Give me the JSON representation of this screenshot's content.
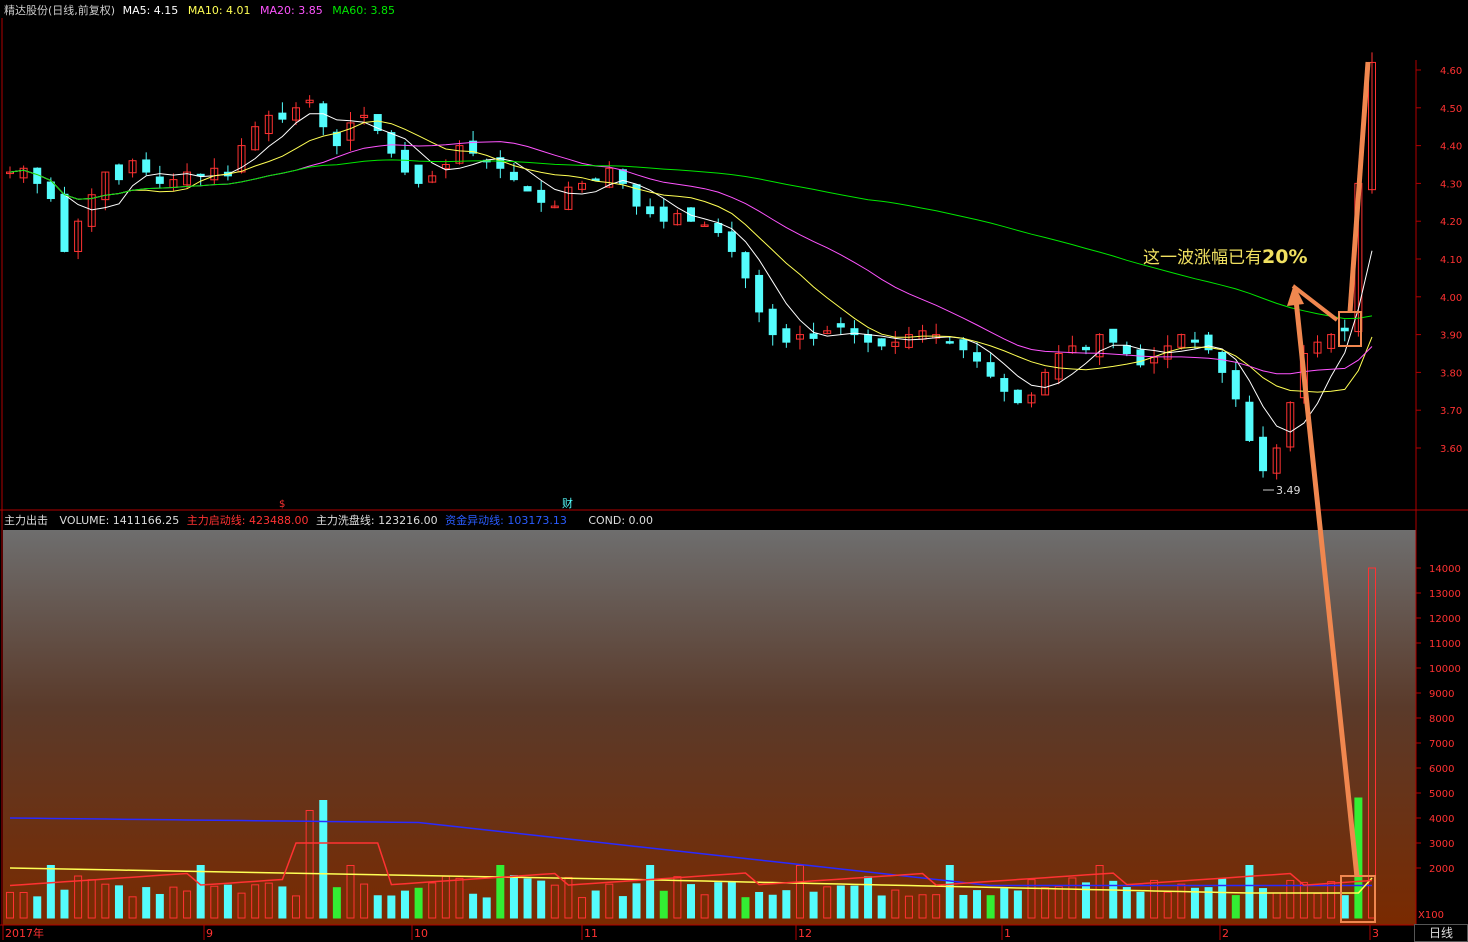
{
  "header": {
    "title": "精达股份(日线,前复权)",
    "ma5": "MA5: 4.15",
    "ma10": "MA10: 4.01",
    "ma20": "MA20: 3.85",
    "ma60": "MA60: 3.85"
  },
  "volume_header": {
    "indicator": "主力出击",
    "volume": "VOLUME: 1411166.25",
    "start_line": "主力启动线: 423488.00",
    "wash_line": "主力洗盘线: 123216.00",
    "fund_line": "资金异动线: 103173.13",
    "cond": "COND: 0.00"
  },
  "annotation": {
    "text": "这一波涨幅已有",
    "pct": "20%"
  },
  "markers": {
    "low_label": "3.49",
    "cai": "财",
    "cai2": "$"
  },
  "x_axis": {
    "labels": [
      "2017年",
      "9",
      "10",
      "11",
      "12",
      "1",
      "2",
      "3"
    ]
  },
  "price_axis": {
    "ticks": [
      "4.60",
      "4.50",
      "4.40",
      "4.30",
      "4.20",
      "4.10",
      "4.00",
      "3.90",
      "3.80",
      "3.70",
      "3.60"
    ]
  },
  "volume_axis": {
    "ticks": [
      "14000",
      "13000",
      "12000",
      "11000",
      "10000",
      "9000",
      "8000",
      "7000",
      "6000",
      "5000",
      "4000",
      "3000",
      "2000"
    ],
    "unit": "X100"
  },
  "corner_tab": "日线",
  "colors": {
    "up": "#ff3232",
    "down": "#54fcfc",
    "ma5": "#ffffff",
    "ma10": "#ffff54",
    "ma20": "#ff54ff",
    "ma60": "#00e600",
    "vol_up_green": "#33ee33",
    "arrow": "#f0874f",
    "axis": "#b00000"
  },
  "chart_data": {
    "type": "candlestick",
    "price_ylim": [
      3.49,
      4.62
    ],
    "volume_ylim": [
      0,
      15000
    ],
    "last_close_approx": 4.62,
    "period_low": 3.49,
    "ma_values": {
      "MA5": 4.15,
      "MA10": 4.01,
      "MA20": 3.85,
      "MA60": 3.85
    },
    "close_path": [
      4.33,
      4.34,
      4.3,
      4.26,
      4.12,
      4.2,
      4.27,
      4.33,
      4.31,
      4.36,
      4.33,
      4.3,
      4.31,
      4.33,
      4.32,
      4.34,
      4.32,
      4.4,
      4.45,
      4.48,
      4.47,
      4.5,
      4.52,
      4.45,
      4.4,
      4.46,
      4.48,
      4.44,
      4.38,
      4.33,
      4.3,
      4.32,
      4.35,
      4.4,
      4.38,
      4.36,
      4.34,
      4.31,
      4.28,
      4.25,
      4.24,
      4.29,
      4.3,
      4.31,
      4.34,
      4.3,
      4.24,
      4.22,
      4.2,
      4.22,
      4.2,
      4.19,
      4.17,
      4.12,
      4.05,
      3.96,
      3.9,
      3.88,
      3.9,
      3.89,
      3.91,
      3.92,
      3.9,
      3.88,
      3.87,
      3.88,
      3.9,
      3.91,
      3.9,
      3.88,
      3.86,
      3.83,
      3.79,
      3.75,
      3.72,
      3.74,
      3.8,
      3.85,
      3.87,
      3.86,
      3.9,
      3.88,
      3.85,
      3.82,
      3.84,
      3.87,
      3.9,
      3.88,
      3.86,
      3.8,
      3.73,
      3.62,
      3.54,
      3.6,
      3.72,
      3.85,
      3.88,
      3.9,
      3.91,
      4.3,
      4.62
    ],
    "volume_series_names": [
      "VOLUME",
      "主力启动线",
      "主力洗盘线",
      "资金异动线"
    ]
  }
}
